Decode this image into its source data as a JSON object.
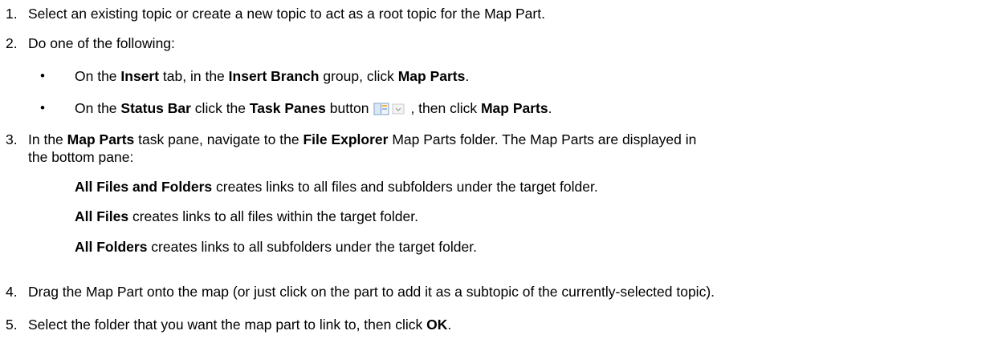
{
  "steps": [
    {
      "number": "1.",
      "text": "Select an existing topic or create a new topic to act as a root topic for the Map Part."
    },
    {
      "number": "2.",
      "text": "Do one of the following:",
      "bullets": [
        {
          "glyph": "•",
          "parts": [
            "On the ",
            "Insert",
            " tab, in the ",
            "Insert Branch",
            " group, click ",
            "Map Parts",
            "."
          ]
        },
        {
          "glyph": "•",
          "parts": [
            "On the ",
            "Status Bar",
            " click the ",
            "Task Panes",
            " button",
            ", then click ",
            "Map Parts",
            "."
          ],
          "icon": "task-panes-button-icon"
        }
      ]
    },
    {
      "number": "3.",
      "parts": [
        "In the ",
        "Map Parts",
        " task pane, navigate to the ",
        "File Explorer",
        " Map Parts folder. The Map Parts are displayed in"
      ],
      "continuation": "the bottom pane:",
      "items": [
        {
          "bold": "All Files and Folders",
          "text": " creates links to all files and subfolders under the target folder."
        },
        {
          "bold": "All Files",
          "text": " creates links to all files within the target folder."
        },
        {
          "bold": "All Folders",
          "text": " creates links to all subfolders under the target folder."
        }
      ]
    },
    {
      "number": "4.",
      "text": "Drag the Map Part onto the map (or just click on the part to add it as a subtopic of the currently-selected topic)."
    },
    {
      "number": "5.",
      "parts": [
        "Select the folder that you want the map part to link to, then click ",
        "OK",
        "."
      ]
    }
  ]
}
